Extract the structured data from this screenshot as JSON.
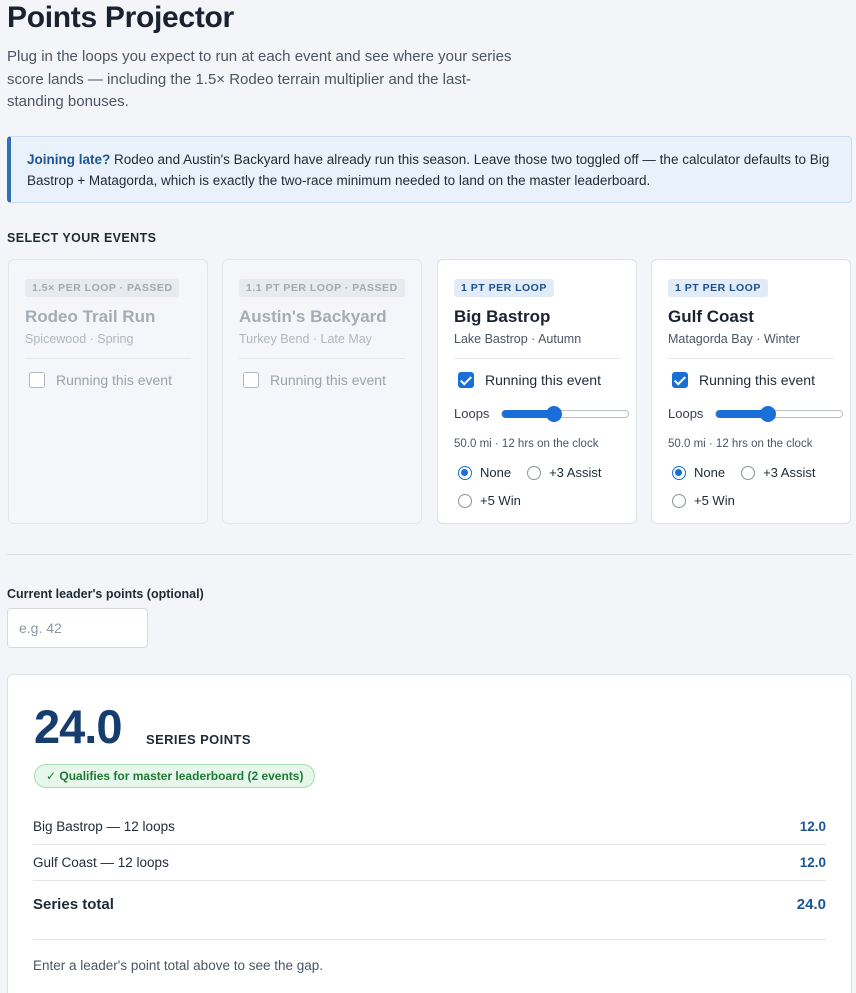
{
  "page": {
    "title": "Points Projector",
    "intro": "Plug in the loops you expect to run at each event and see where your series score lands — including the 1.5× Rodeo terrain multiplier and the last-standing bonuses."
  },
  "notice": {
    "lead": "Joining late?",
    "text": " Rodeo and Austin's Backyard have already run this season. Leave those two toggled off — the calculator defaults to Big Bastrop + Matagorda, which is exactly the two-race minimum needed to land on the master leaderboard."
  },
  "events_section": {
    "label": "SELECT YOUR EVENTS"
  },
  "events": [
    {
      "badge": "1.5× PER LOOP · PASSED",
      "name": "Rodeo Trail Run",
      "sub": "Spicewood · Spring",
      "run_label": "Running this event",
      "running": false
    },
    {
      "badge": "1.1 PT PER LOOP · PASSED",
      "name": "Austin's Backyard",
      "sub": "Turkey Bend · Late May",
      "run_label": "Running this event",
      "running": false
    },
    {
      "badge": "1 PT PER LOOP",
      "name": "Big Bastrop",
      "sub": "Lake Bastrop · Autumn",
      "run_label": "Running this event",
      "running": true,
      "loops_label": "Loops",
      "loops_fraction": 0.41,
      "meta": "50.0 mi · 12 hrs on the clock",
      "bonus_options": [
        "None",
        "+3 Assist",
        "+5 Win"
      ],
      "bonus_selected": "None"
    },
    {
      "badge": "1 PT PER LOOP",
      "name": "Gulf Coast",
      "sub": "Matagorda Bay · Winter",
      "run_label": "Running this event",
      "running": true,
      "loops_label": "Loops",
      "loops_fraction": 0.41,
      "meta": "50.0 mi · 12 hrs on the clock",
      "bonus_options": [
        "None",
        "+3 Assist",
        "+5 Win"
      ],
      "bonus_selected": "None"
    }
  ],
  "leader": {
    "label": "Current leader's points (optional)",
    "placeholder": "e.g. 42",
    "value": ""
  },
  "results": {
    "total_points": "24.0",
    "points_label": "SERIES POINTS",
    "qualify_badge": "✓ Qualifies for master leaderboard (2 events)",
    "rows": [
      {
        "label": "Big Bastrop — 12 loops",
        "value": "12.0"
      },
      {
        "label": "Gulf Coast — 12 loops",
        "value": "12.0"
      }
    ],
    "total_label": "Series total",
    "total_value": "24.0",
    "gap_note": "Enter a leader's point total above to see the gap."
  },
  "colors": {
    "accent": "#1a6ed8",
    "headline_number": "#173d6e",
    "qualify_green": "#1e7b35"
  }
}
